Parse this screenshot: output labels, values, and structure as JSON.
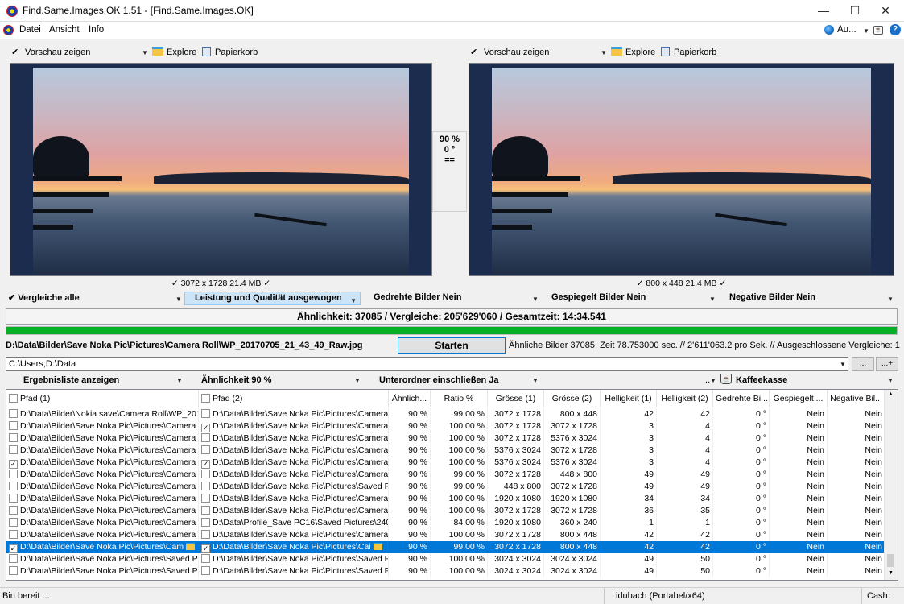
{
  "window": {
    "title": "Find.Same.Images.OK 1.51 - [Find.Same.Images.OK]",
    "minimize": "—",
    "maximize": "☐",
    "close": "✕"
  },
  "menu": {
    "items": [
      "Datei",
      "Ansicht",
      "Info"
    ],
    "language": "Au...",
    "help": "?"
  },
  "left_toolbar": {
    "preview": "Vorschau zeigen",
    "explore": "Explore",
    "trash": "Papierkorb"
  },
  "right_toolbar": {
    "preview": "Vorschau zeigen",
    "explore": "Explore",
    "trash": "Papierkorb"
  },
  "compare": {
    "percent": "90 %",
    "rotation": "0 °",
    "equal": "=="
  },
  "left_info": "✓ 3072 x 1728 21.4 MB ✓",
  "right_info": "✓ 800 x 448 21.4 MB ✓",
  "options": {
    "compare_all": "Vergleiche alle",
    "quality": "Leistung und Qualität ausgewogen",
    "rotated": "Gedrehte Bilder Nein",
    "mirrored": "Gespiegelt Bilder Nein",
    "negative": "Negative Bilder Nein"
  },
  "summary": "Ähnlichkeit: 37085 / Vergleiche: 205'629'060 / Gesamtzeit: 14:34.541",
  "progress": 1.0,
  "current_path": "D:\\Data\\Bilder\\Save Noka Pic\\Pictures\\Camera Roll\\WP_20170705_21_43_49_Raw.jpg",
  "start_button": "Starten",
  "status_line": "Ähnliche Bilder 37085, Zeit 78.753000 sec. // 2'611'063.2 pro Sek. // Ausgeschlossene Vergleiche: 1",
  "folders": "C:\\Users;D:\\Data",
  "folder_btn1": "...",
  "folder_btn2": "...+",
  "result_bar": {
    "show_list": "Ergebnisliste anzeigen",
    "similarity": "Ähnlichkeit 90 %",
    "subfolders": "Unterordner einschließen Ja",
    "more": "...",
    "coffee": "Kaffeekasse"
  },
  "columns": [
    "Pfad (1)",
    "Pfad (2)",
    "Ähnlich...",
    "Ratio %",
    "Grösse (1)",
    "Grösse (2)",
    "Helligkeit (1)",
    "Helligkeit (2)",
    "Gedrehte Bi...",
    "Gespiegelt ...",
    "Negative Bil..."
  ],
  "rows": [
    {
      "c1": false,
      "p1": "D:\\Data\\Bilder\\Nokia save\\Camera Roll\\WP_201...",
      "c2": false,
      "p2": "D:\\Data\\Bilder\\Save Noka Pic\\Pictures\\Camera ...",
      "sim": "90 %",
      "ratio": "99.00 %",
      "s1": "3072 x 1728",
      "s2": "800 x 448",
      "h1": "42",
      "h2": "42",
      "rot": "0 °",
      "mir": "Nein",
      "neg": "Nein"
    },
    {
      "c1": false,
      "p1": "D:\\Data\\Bilder\\Save Noka Pic\\Pictures\\Camera R...",
      "c2": true,
      "p2": "D:\\Data\\Bilder\\Save Noka Pic\\Pictures\\Camera ...",
      "sim": "90 %",
      "ratio": "100.00 %",
      "s1": "3072 x 1728",
      "s2": "3072 x 1728",
      "h1": "3",
      "h2": "4",
      "rot": "0 °",
      "mir": "Nein",
      "neg": "Nein"
    },
    {
      "c1": false,
      "p1": "D:\\Data\\Bilder\\Save Noka Pic\\Pictures\\Camera R...",
      "c2": false,
      "p2": "D:\\Data\\Bilder\\Save Noka Pic\\Pictures\\Camera ...",
      "sim": "90 %",
      "ratio": "100.00 %",
      "s1": "3072 x 1728",
      "s2": "5376 x 3024",
      "h1": "3",
      "h2": "4",
      "rot": "0 °",
      "mir": "Nein",
      "neg": "Nein"
    },
    {
      "c1": false,
      "p1": "D:\\Data\\Bilder\\Save Noka Pic\\Pictures\\Camera R...",
      "c2": false,
      "p2": "D:\\Data\\Bilder\\Save Noka Pic\\Pictures\\Camera ...",
      "sim": "90 %",
      "ratio": "100.00 %",
      "s1": "5376 x 3024",
      "s2": "3072 x 1728",
      "h1": "3",
      "h2": "4",
      "rot": "0 °",
      "mir": "Nein",
      "neg": "Nein"
    },
    {
      "c1": true,
      "p1": "D:\\Data\\Bilder\\Save Noka Pic\\Pictures\\Camera R...",
      "c2": true,
      "p2": "D:\\Data\\Bilder\\Save Noka Pic\\Pictures\\Camera ...",
      "sim": "90 %",
      "ratio": "100.00 %",
      "s1": "5376 x 3024",
      "s2": "5376 x 3024",
      "h1": "3",
      "h2": "4",
      "rot": "0 °",
      "mir": "Nein",
      "neg": "Nein"
    },
    {
      "c1": false,
      "p1": "D:\\Data\\Bilder\\Save Noka Pic\\Pictures\\Camera R...",
      "c2": false,
      "p2": "D:\\Data\\Bilder\\Save Noka Pic\\Pictures\\Camera ...",
      "sim": "90 %",
      "ratio": "99.00 %",
      "s1": "3072 x 1728",
      "s2": "448 x 800",
      "h1": "49",
      "h2": "49",
      "rot": "0 °",
      "mir": "Nein",
      "neg": "Nein"
    },
    {
      "c1": false,
      "p1": "D:\\Data\\Bilder\\Save Noka Pic\\Pictures\\Camera R...",
      "c2": false,
      "p2": "D:\\Data\\Bilder\\Save Noka Pic\\Pictures\\Saved Pi...",
      "sim": "90 %",
      "ratio": "99.00 %",
      "s1": "448 x 800",
      "s2": "3072 x 1728",
      "h1": "49",
      "h2": "49",
      "rot": "0 °",
      "mir": "Nein",
      "neg": "Nein"
    },
    {
      "c1": false,
      "p1": "D:\\Data\\Bilder\\Save Noka Pic\\Pictures\\Camera R...",
      "c2": false,
      "p2": "D:\\Data\\Bilder\\Save Noka Pic\\Pictures\\Camera ...",
      "sim": "90 %",
      "ratio": "100.00 %",
      "s1": "1920 x 1080",
      "s2": "1920 x 1080",
      "h1": "34",
      "h2": "34",
      "rot": "0 °",
      "mir": "Nein",
      "neg": "Nein"
    },
    {
      "c1": false,
      "p1": "D:\\Data\\Bilder\\Save Noka Pic\\Pictures\\Camera R...",
      "c2": false,
      "p2": "D:\\Data\\Bilder\\Save Noka Pic\\Pictures\\Camera ...",
      "sim": "90 %",
      "ratio": "100.00 %",
      "s1": "3072 x 1728",
      "s2": "3072 x 1728",
      "h1": "36",
      "h2": "35",
      "rot": "0 °",
      "mir": "Nein",
      "neg": "Nein"
    },
    {
      "c1": false,
      "p1": "D:\\Data\\Bilder\\Save Noka Pic\\Pictures\\Camera R...",
      "c2": false,
      "p2": "D:\\Data\\Profile_Save PC16\\Saved Pictures\\240...",
      "sim": "90 %",
      "ratio": "84.00 %",
      "s1": "1920 x 1080",
      "s2": "360 x 240",
      "h1": "1",
      "h2": "1",
      "rot": "0 °",
      "mir": "Nein",
      "neg": "Nein"
    },
    {
      "c1": false,
      "p1": "D:\\Data\\Bilder\\Save Noka Pic\\Pictures\\Camera R...",
      "c2": false,
      "p2": "D:\\Data\\Bilder\\Save Noka Pic\\Pictures\\Camera ...",
      "sim": "90 %",
      "ratio": "100.00 %",
      "s1": "3072 x 1728",
      "s2": "800 x 448",
      "h1": "42",
      "h2": "42",
      "rot": "0 °",
      "mir": "Nein",
      "neg": "Nein"
    },
    {
      "c1": true,
      "p1": "D:\\Data\\Bilder\\Save Noka Pic\\Pictures\\Cam",
      "c2": true,
      "p2": "D:\\Data\\Bilder\\Save Noka Pic\\Pictures\\Cai",
      "sim": "90 %",
      "ratio": "99.00 %",
      "s1": "3072 x 1728",
      "s2": "800 x 448",
      "h1": "42",
      "h2": "42",
      "rot": "0 °",
      "mir": "Nein",
      "neg": "Nein",
      "selected": true
    },
    {
      "c1": false,
      "p1": "D:\\Data\\Bilder\\Save Noka Pic\\Pictures\\Saved Pi...",
      "c2": false,
      "p2": "D:\\Data\\Bilder\\Save Noka Pic\\Pictures\\Saved Pi...",
      "sim": "90 %",
      "ratio": "100.00 %",
      "s1": "3024 x 3024",
      "s2": "3024 x 3024",
      "h1": "49",
      "h2": "50",
      "rot": "0 °",
      "mir": "Nein",
      "neg": "Nein"
    },
    {
      "c1": false,
      "p1": "D:\\Data\\Bilder\\Save Noka Pic\\Pictures\\Saved Pic...",
      "c2": false,
      "p2": "D:\\Data\\Bilder\\Save Noka Pic\\Pictures\\Saved Pi...",
      "sim": "90 %",
      "ratio": "100.00 %",
      "s1": "3024 x 3024",
      "s2": "3024 x 3024",
      "h1": "49",
      "h2": "50",
      "rot": "0 °",
      "mir": "Nein",
      "neg": "Nein"
    }
  ],
  "statusbar": {
    "ready": "Bin bereit ...",
    "user": "idubach (Portabel/x64)",
    "cash": "Cash:"
  },
  "colors": {
    "accent": "#0078d7",
    "progress": "#06b025",
    "selected_row": "#0078d7"
  }
}
